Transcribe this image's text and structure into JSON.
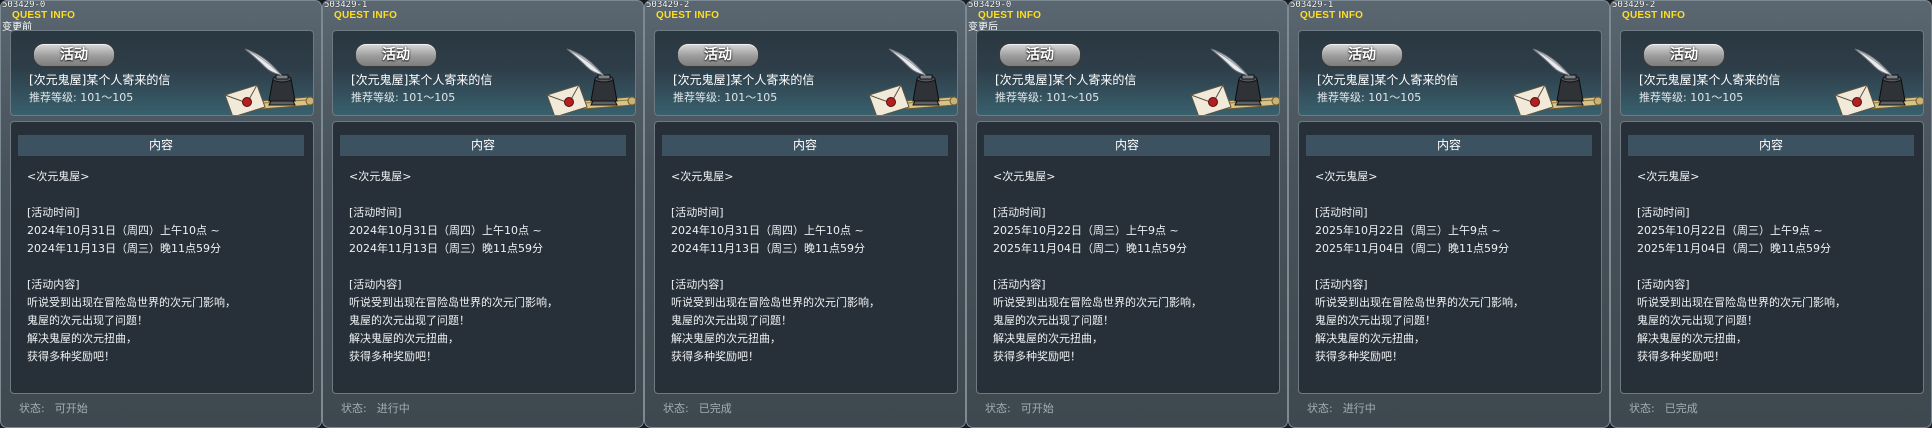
{
  "panels": [
    {
      "id": "503429-0",
      "header": "QUEST INFO",
      "note": "变更前",
      "badge": "活动",
      "title": "[次元鬼屋]某个人寄来的信",
      "level": "推荐等级: 101～105",
      "content_header": "内容",
      "lines": [
        "<次元鬼屋>",
        "",
        "[活动时间]",
        "2024年10月31日（周四）上午10点 ~",
        "2024年11月13日（周三）晚11点59分",
        "",
        "[活动内容]",
        "听说受到出现在冒险岛世界的次元门影响，",
        "鬼屋的次元出现了问题！",
        "解决鬼屋的次元扭曲，",
        "获得多种奖励吧！"
      ],
      "status_label": "状态:",
      "status_value": "可开始"
    },
    {
      "id": "503429-1",
      "header": "QUEST INFO",
      "note": "",
      "badge": "活动",
      "title": "[次元鬼屋]某个人寄来的信",
      "level": "推荐等级: 101～105",
      "content_header": "内容",
      "lines": [
        "<次元鬼屋>",
        "",
        "[活动时间]",
        "2024年10月31日（周四）上午10点 ~",
        "2024年11月13日（周三）晚11点59分",
        "",
        "[活动内容]",
        "听说受到出现在冒险岛世界的次元门影响，",
        "鬼屋的次元出现了问题！",
        "解决鬼屋的次元扭曲，",
        "获得多种奖励吧！"
      ],
      "status_label": "状态:",
      "status_value": "进行中"
    },
    {
      "id": "503429-2",
      "header": "QUEST INFO",
      "note": "",
      "badge": "活动",
      "title": "[次元鬼屋]某个人寄来的信",
      "level": "推荐等级: 101～105",
      "content_header": "内容",
      "lines": [
        "<次元鬼屋>",
        "",
        "[活动时间]",
        "2024年10月31日（周四）上午10点 ~",
        "2024年11月13日（周三）晚11点59分",
        "",
        "[活动内容]",
        "听说受到出现在冒险岛世界的次元门影响，",
        "鬼屋的次元出现了问题！",
        "解决鬼屋的次元扭曲，",
        "获得多种奖励吧！"
      ],
      "status_label": "状态:",
      "status_value": "已完成"
    },
    {
      "id": "503429-0",
      "header": "QUEST INFO",
      "note": "变更后",
      "badge": "活动",
      "title": "[次元鬼屋]某个人寄来的信",
      "level": "推荐等级: 101～105",
      "content_header": "内容",
      "lines": [
        "<次元鬼屋>",
        "",
        "[活动时间]",
        "2025年10月22日（周三）上午9点 ~",
        "2025年11月04日（周二）晚11点59分",
        "",
        "[活动内容]",
        "听说受到出现在冒险岛世界的次元门影响，",
        "鬼屋的次元出现了问题！",
        "解决鬼屋的次元扭曲，",
        "获得多种奖励吧！"
      ],
      "status_label": "状态:",
      "status_value": "可开始"
    },
    {
      "id": "503429-1",
      "header": "QUEST INFO",
      "note": "",
      "badge": "活动",
      "title": "[次元鬼屋]某个人寄来的信",
      "level": "推荐等级: 101～105",
      "content_header": "内容",
      "lines": [
        "<次元鬼屋>",
        "",
        "[活动时间]",
        "2025年10月22日（周三）上午9点 ~",
        "2025年11月04日（周二）晚11点59分",
        "",
        "[活动内容]",
        "听说受到出现在冒险岛世界的次元门影响，",
        "鬼屋的次元出现了问题！",
        "解决鬼屋的次元扭曲，",
        "获得多种奖励吧！"
      ],
      "status_label": "状态:",
      "status_value": "进行中"
    },
    {
      "id": "503429-2",
      "header": "QUEST INFO",
      "note": "",
      "badge": "活动",
      "title": "[次元鬼屋]某个人寄来的信",
      "level": "推荐等级: 101～105",
      "content_header": "内容",
      "lines": [
        "<次元鬼屋>",
        "",
        "[活动时间]",
        "2025年10月22日（周三）上午9点 ~",
        "2025年11月04日（周二）晚11点59分",
        "",
        "[活动内容]",
        "听说受到出现在冒险岛世界的次元门影响，",
        "鬼屋的次元出现了问题！",
        "解决鬼屋的次元扭曲，",
        "获得多种奖励吧！"
      ],
      "status_label": "状态:",
      "status_value": "已完成"
    }
  ],
  "icons": {
    "banner_icon": "letter-quill-inkwell-icon"
  },
  "colors": {
    "header_yellow": "#ffdd22",
    "content_header_bg": "#3d5260",
    "status_gray": "#a3adb4"
  }
}
